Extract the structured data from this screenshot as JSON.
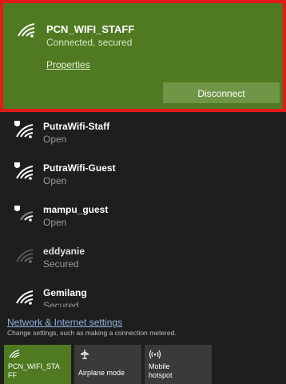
{
  "connected": {
    "name": "PCN_WIFI_STAFF",
    "status": "Connected, secured",
    "properties_label": "Properties",
    "disconnect_label": "Disconnect"
  },
  "networks": [
    {
      "name": "PutraWifi-Staff",
      "status": "Open"
    },
    {
      "name": "PutraWifi-Guest",
      "status": "Open"
    },
    {
      "name": "mampu_guest",
      "status": "Open"
    },
    {
      "name": "eddyanie",
      "status": "Secured"
    },
    {
      "name": "Gemilang",
      "status": "Secured"
    }
  ],
  "settings": {
    "link": "Network & Internet settings",
    "sub": "Change settings, such as making a connection metered."
  },
  "tiles": [
    {
      "label1": "PCN_WIFI_STA",
      "label2": "FF"
    },
    {
      "label1": "Airplane mode",
      "label2": ""
    },
    {
      "label1": "Mobile",
      "label2": "hotspot"
    }
  ],
  "colors": {
    "accent": "#4f7a21",
    "highlight_border": "#e21a1a",
    "background": "#1e1e1e"
  },
  "icons": {
    "wifi": "wifi-icon",
    "wifi_open": "wifi-open-shield-icon",
    "airplane": "airplane-icon",
    "hotspot": "hotspot-icon"
  }
}
